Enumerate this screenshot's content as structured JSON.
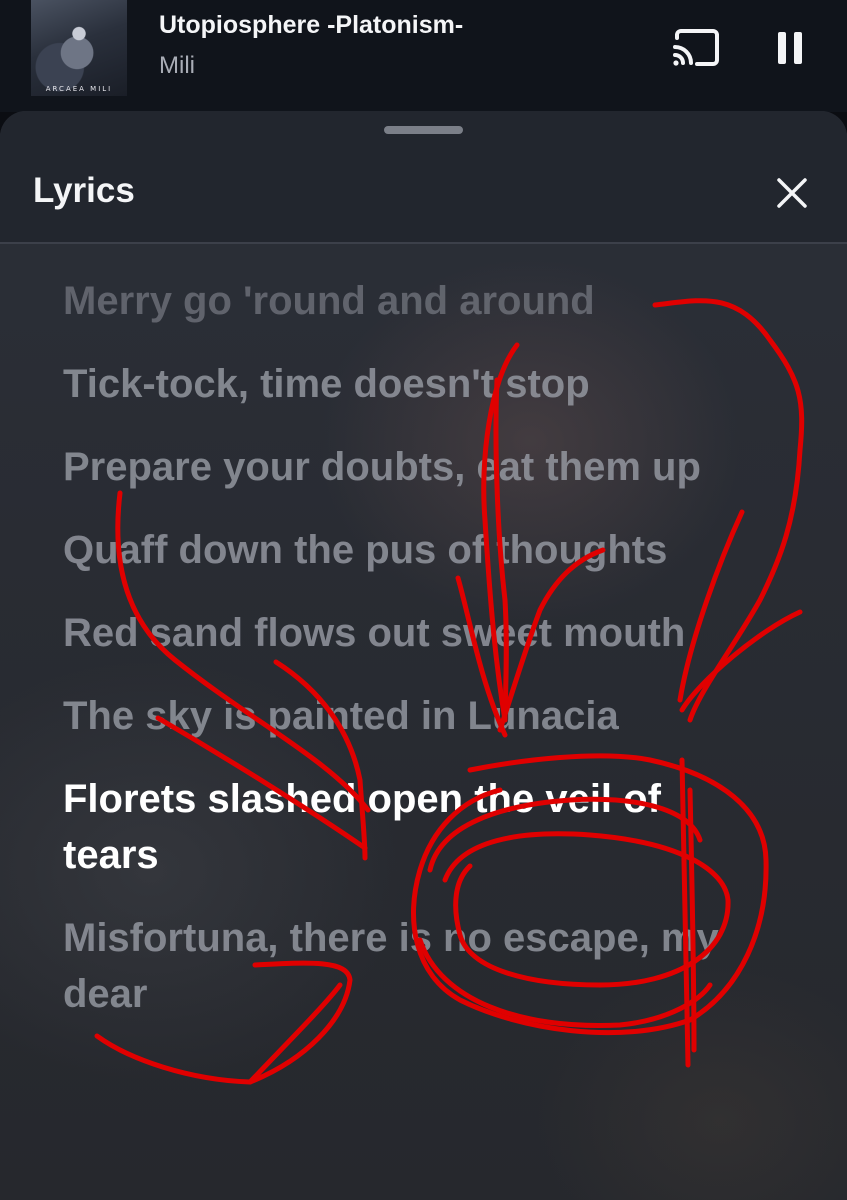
{
  "now_playing": {
    "title": "Utopiosphere -Platonism-",
    "artist": "Mili",
    "album_art_caption": "ARCAEA MILI",
    "cast_icon": "cast-icon",
    "pause_icon": "pause-icon"
  },
  "lyrics_sheet": {
    "title": "Lyrics",
    "close_icon": "close-icon",
    "lines": [
      {
        "text": "Merry go 'round and around",
        "state": "faded"
      },
      {
        "text": "Tick-tock, time doesn't stop",
        "state": "inactive"
      },
      {
        "text": "Prepare your doubts, eat them up",
        "state": "inactive"
      },
      {
        "text": "Quaff down the pus of thoughts",
        "state": "inactive"
      },
      {
        "text": "Red sand flows out sweet mouth",
        "state": "inactive"
      },
      {
        "text": "The sky is painted in Lunacia",
        "state": "inactive"
      },
      {
        "text": "Florets slashed open the veil of tears",
        "state": "active"
      },
      {
        "text": "Misfortuna, there is no escape, my dear",
        "state": "inactive"
      }
    ]
  },
  "colors": {
    "annotation_red": "#e00000",
    "active_lyric": "#ffffff",
    "inactive_lyric": "#9b9fa8"
  }
}
